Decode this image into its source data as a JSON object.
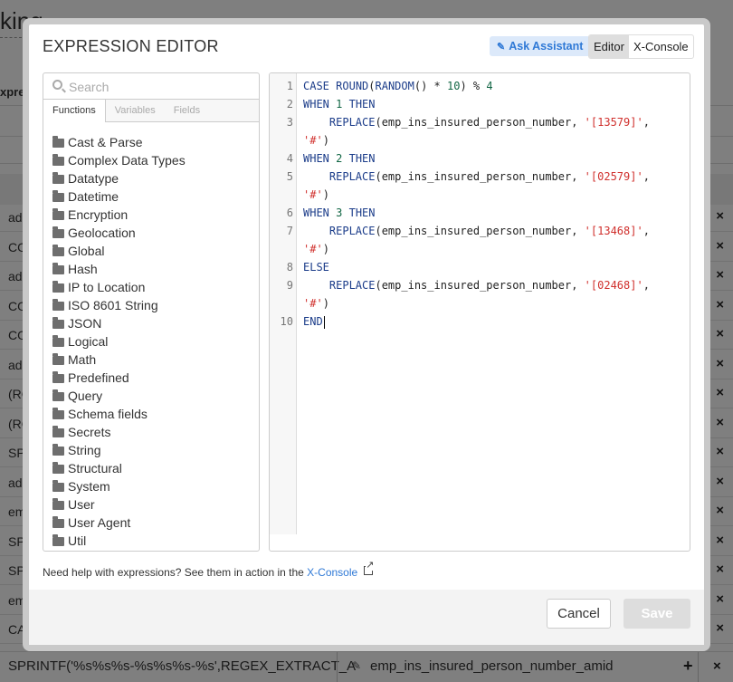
{
  "background": {
    "title_fragment": "king",
    "column_header_fragment": "xpre",
    "rows": [
      "ad",
      "CO",
      "ad",
      "CO",
      "CO",
      "ad",
      "(RO",
      "(RO",
      "SP",
      "ad",
      "em",
      "SP",
      "SP",
      "em",
      "CA"
    ],
    "bottom_formula": "SPRINTF('%s%s%s-%s%s%s-%s',REGEX_EXTRACT_A",
    "bottom_name": "emp_ins_insured_person_number_amid"
  },
  "modal": {
    "title": "EXPRESSION EDITOR",
    "ask_assistant_label": "Ask Assistant",
    "mode_options": [
      {
        "label": "Editor",
        "active": true
      },
      {
        "label": "X-Console",
        "active": false
      }
    ],
    "search_placeholder": "Search",
    "tabs": [
      {
        "label": "Functions",
        "active": true
      },
      {
        "label": "Variables",
        "active": false
      },
      {
        "label": "Fields",
        "active": false
      }
    ],
    "categories": [
      "Cast & Parse",
      "Complex Data Types",
      "Datatype",
      "Datetime",
      "Encryption",
      "Geolocation",
      "Global",
      "Hash",
      "IP to Location",
      "ISO 8601 String",
      "JSON",
      "Logical",
      "Math",
      "Predefined",
      "Query",
      "Schema fields",
      "Secrets",
      "String",
      "Structural",
      "System",
      "User",
      "User Agent",
      "Util"
    ],
    "code_lines": [
      {
        "n": "1",
        "text": "CASE ROUND(RANDOM() * 10) % 4"
      },
      {
        "n": "2",
        "text": "WHEN 1 THEN"
      },
      {
        "n": "3",
        "text": "    REPLACE(emp_ins_insured_person_number, '[13579]',"
      },
      {
        "n": "",
        "text": "'#')"
      },
      {
        "n": "4",
        "text": "WHEN 2 THEN"
      },
      {
        "n": "5",
        "text": "    REPLACE(emp_ins_insured_person_number, '[02579]',"
      },
      {
        "n": "",
        "text": "'#')"
      },
      {
        "n": "6",
        "text": "WHEN 3 THEN"
      },
      {
        "n": "7",
        "text": "    REPLACE(emp_ins_insured_person_number, '[13468]',"
      },
      {
        "n": "",
        "text": "'#')"
      },
      {
        "n": "8",
        "text": "ELSE"
      },
      {
        "n": "9",
        "text": "    REPLACE(emp_ins_insured_person_number, '[02468]',"
      },
      {
        "n": "",
        "text": "'#')"
      },
      {
        "n": "10",
        "text": "END"
      }
    ],
    "help_text": "Need help with expressions? See them in action in the ",
    "help_link": "X-Console",
    "cancel_label": "Cancel",
    "save_label": "Save"
  },
  "colors": {
    "accent": "#2f79d6",
    "keyword": "#1c3d8a",
    "number": "#116644",
    "string": "#d0302d"
  }
}
